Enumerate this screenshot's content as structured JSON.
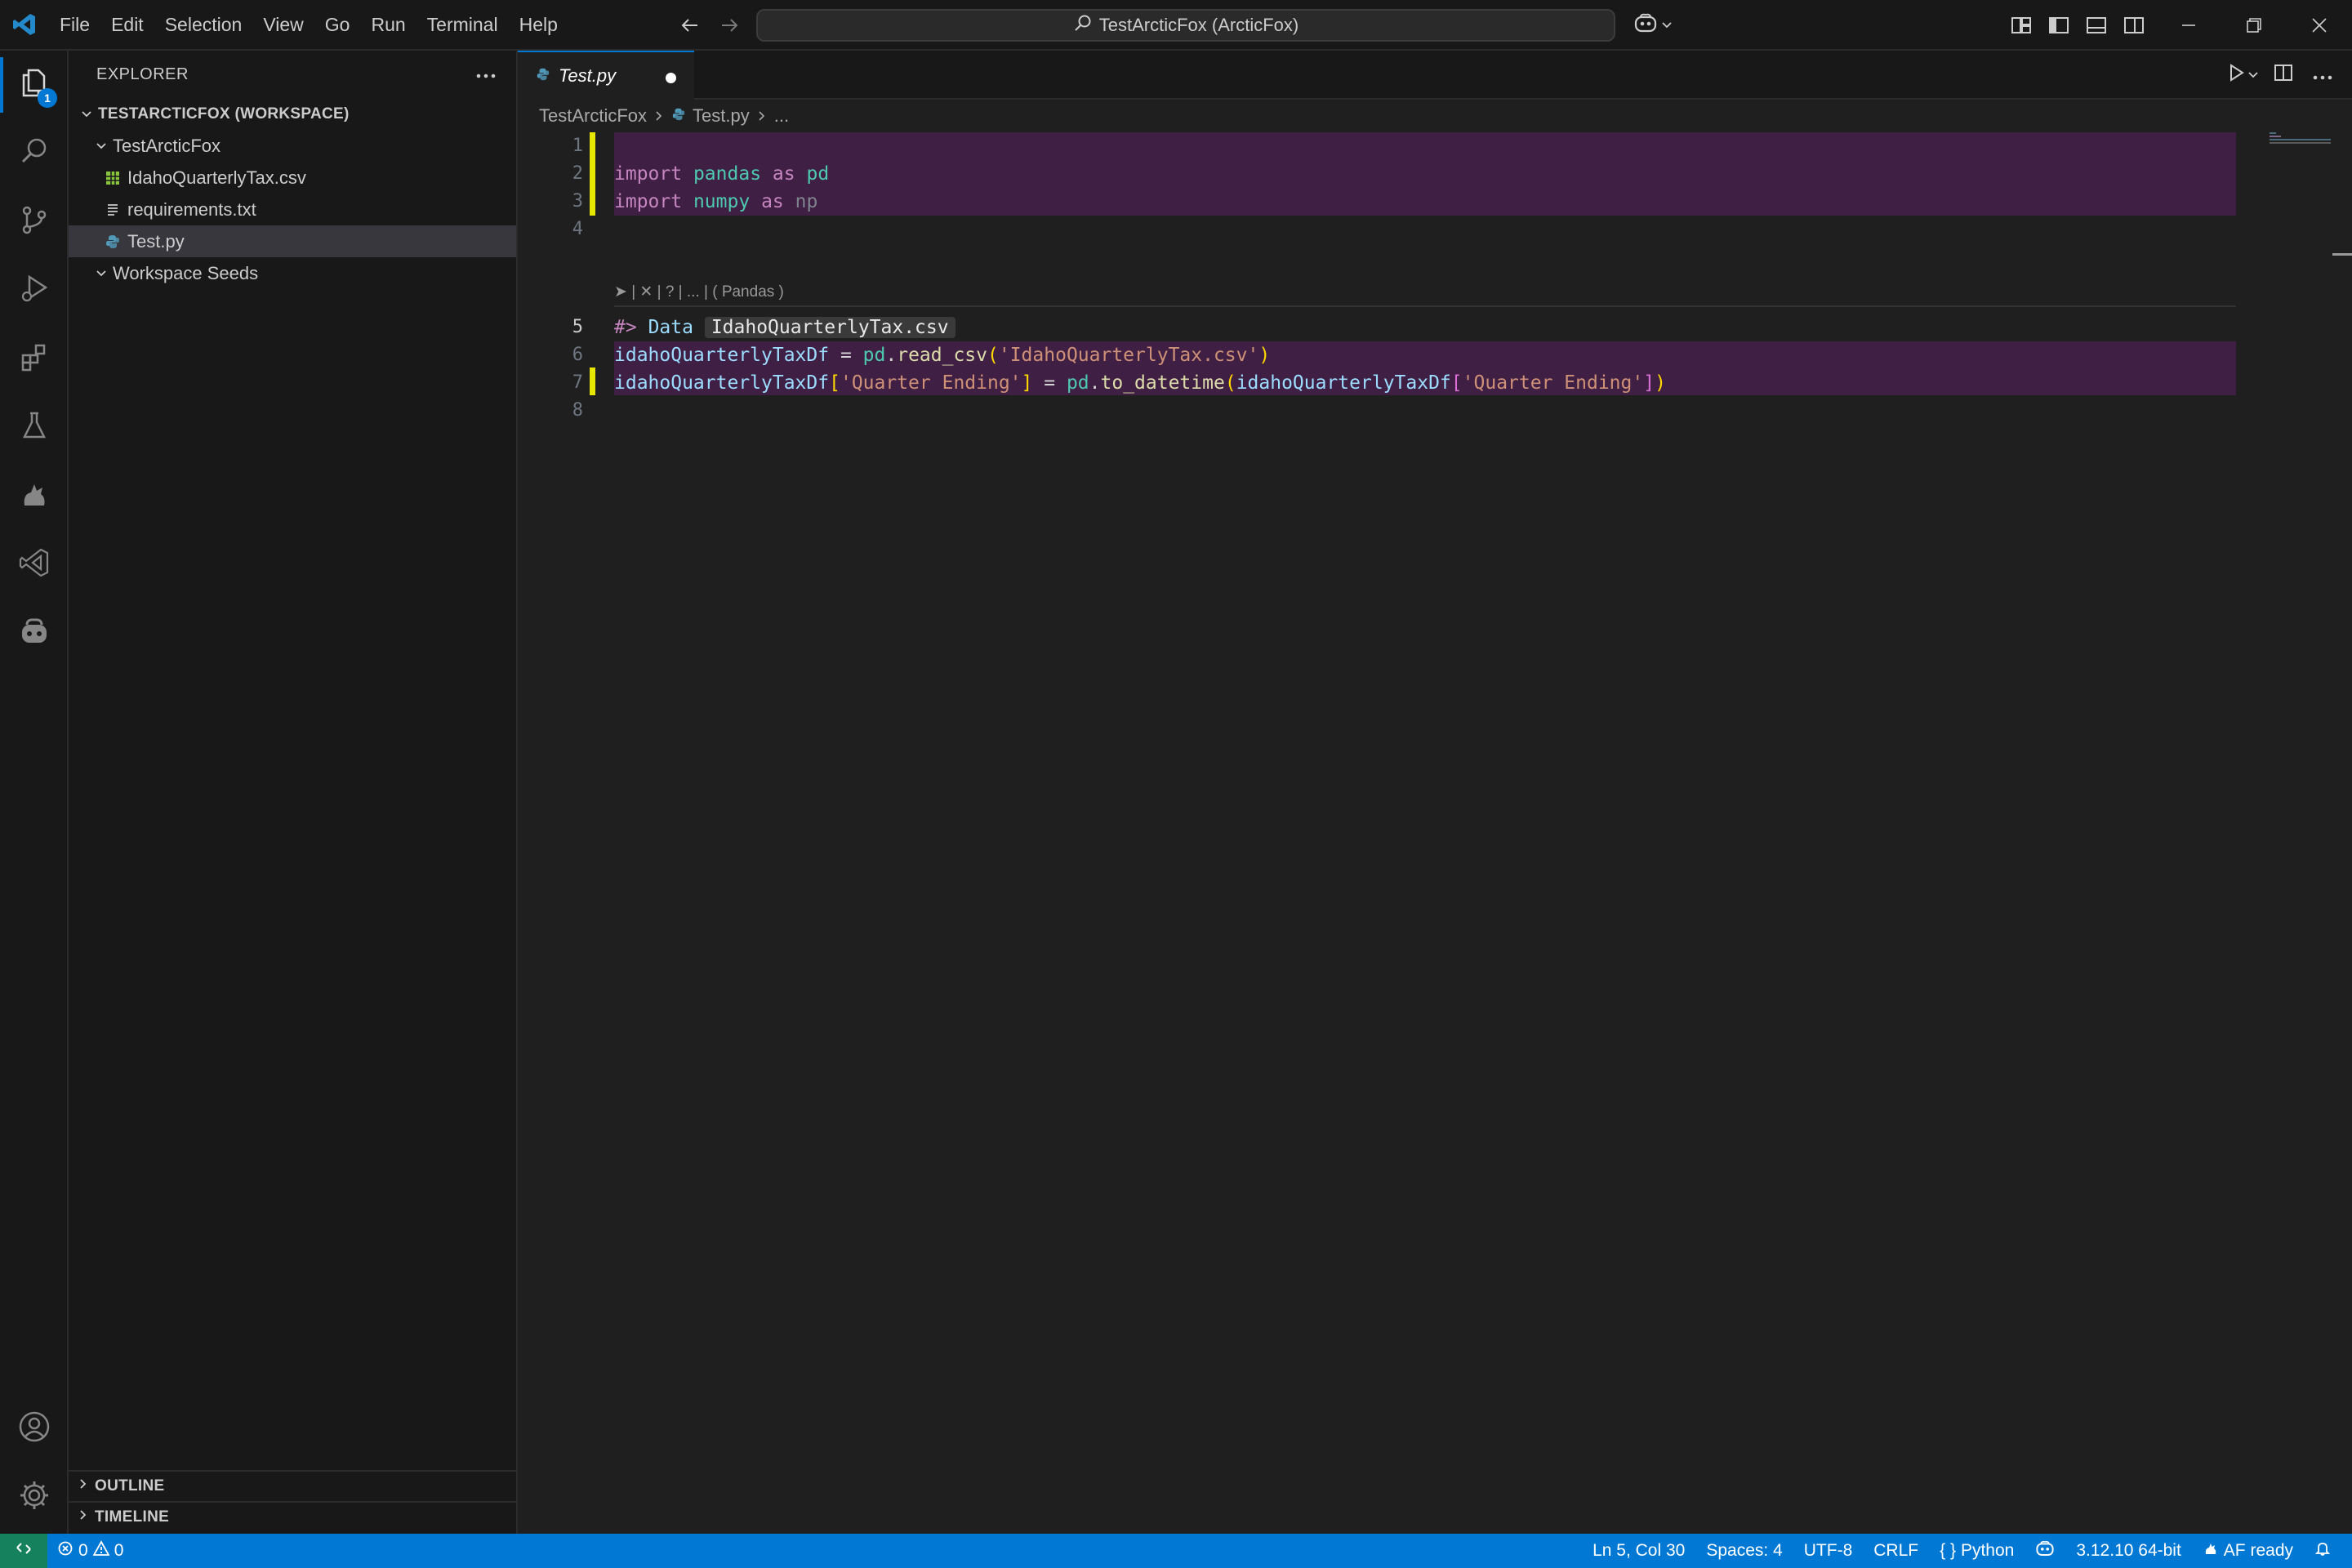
{
  "titlebar": {
    "menu": [
      "File",
      "Edit",
      "Selection",
      "View",
      "Go",
      "Run",
      "Terminal",
      "Help"
    ],
    "command_center": "TestArcticFox (ArcticFox)"
  },
  "activity": {
    "explorer_badge": "1"
  },
  "sidebar": {
    "header": "EXPLORER",
    "workspace_title": "TESTARCTICFOX (WORKSPACE)",
    "folder": "TestArcticFox",
    "files": [
      "IdahoQuarterlyTax.csv",
      "requirements.txt",
      "Test.py"
    ],
    "folder2": "Workspace Seeds",
    "outline": "OUTLINE",
    "timeline": "TIMELINE"
  },
  "editor": {
    "tab_label": "Test.py",
    "breadcrumb": {
      "folder": "TestArcticFox",
      "file": "Test.py",
      "more": "..."
    },
    "line_numbers": [
      "1",
      "2",
      "3",
      "4",
      "5",
      "6",
      "7",
      "8"
    ],
    "codelens": "➤ | ✕ | ? | ... | ( Pandas )",
    "code": {
      "l2_import": "import",
      "l2_mod": "pandas",
      "l2_as": "as",
      "l2_alias": "pd",
      "l3_import": "import",
      "l3_mod": "numpy",
      "l3_as": "as",
      "l3_alias": "np",
      "l5_magic": "#>",
      "l5_data": "Data",
      "l5_file": "IdahoQuarterlyTax.csv",
      "l6_var": "idahoQuarterlyTaxDf",
      "l6_eq": " = ",
      "l6_pd": "pd",
      "l6_dot": ".",
      "l6_fn": "read_csv",
      "l6_open": "(",
      "l6_str": "'IdahoQuarterlyTax.csv'",
      "l6_close": ")",
      "l7_var": "idahoQuarterlyTaxDf",
      "l7_ob": "[",
      "l7_str": "'Quarter Ending'",
      "l7_cb": "]",
      "l7_eq": " = ",
      "l7_pd": "pd",
      "l7_dot": ".",
      "l7_fn": "to_datetime",
      "l7_op": "(",
      "l7_var2": "idahoQuarterlyTaxDf",
      "l7_ob2": "[",
      "l7_str2": "'Quarter Ending'",
      "l7_cb2": "]",
      "l7_cp": ")"
    }
  },
  "statusbar": {
    "errors": "0",
    "warnings": "0",
    "position": "Ln 5, Col 30",
    "spaces": "Spaces: 4",
    "encoding": "UTF-8",
    "eol": "CRLF",
    "language": "Python",
    "interpreter": "3.12.10 64-bit",
    "af_status": "AF ready"
  }
}
